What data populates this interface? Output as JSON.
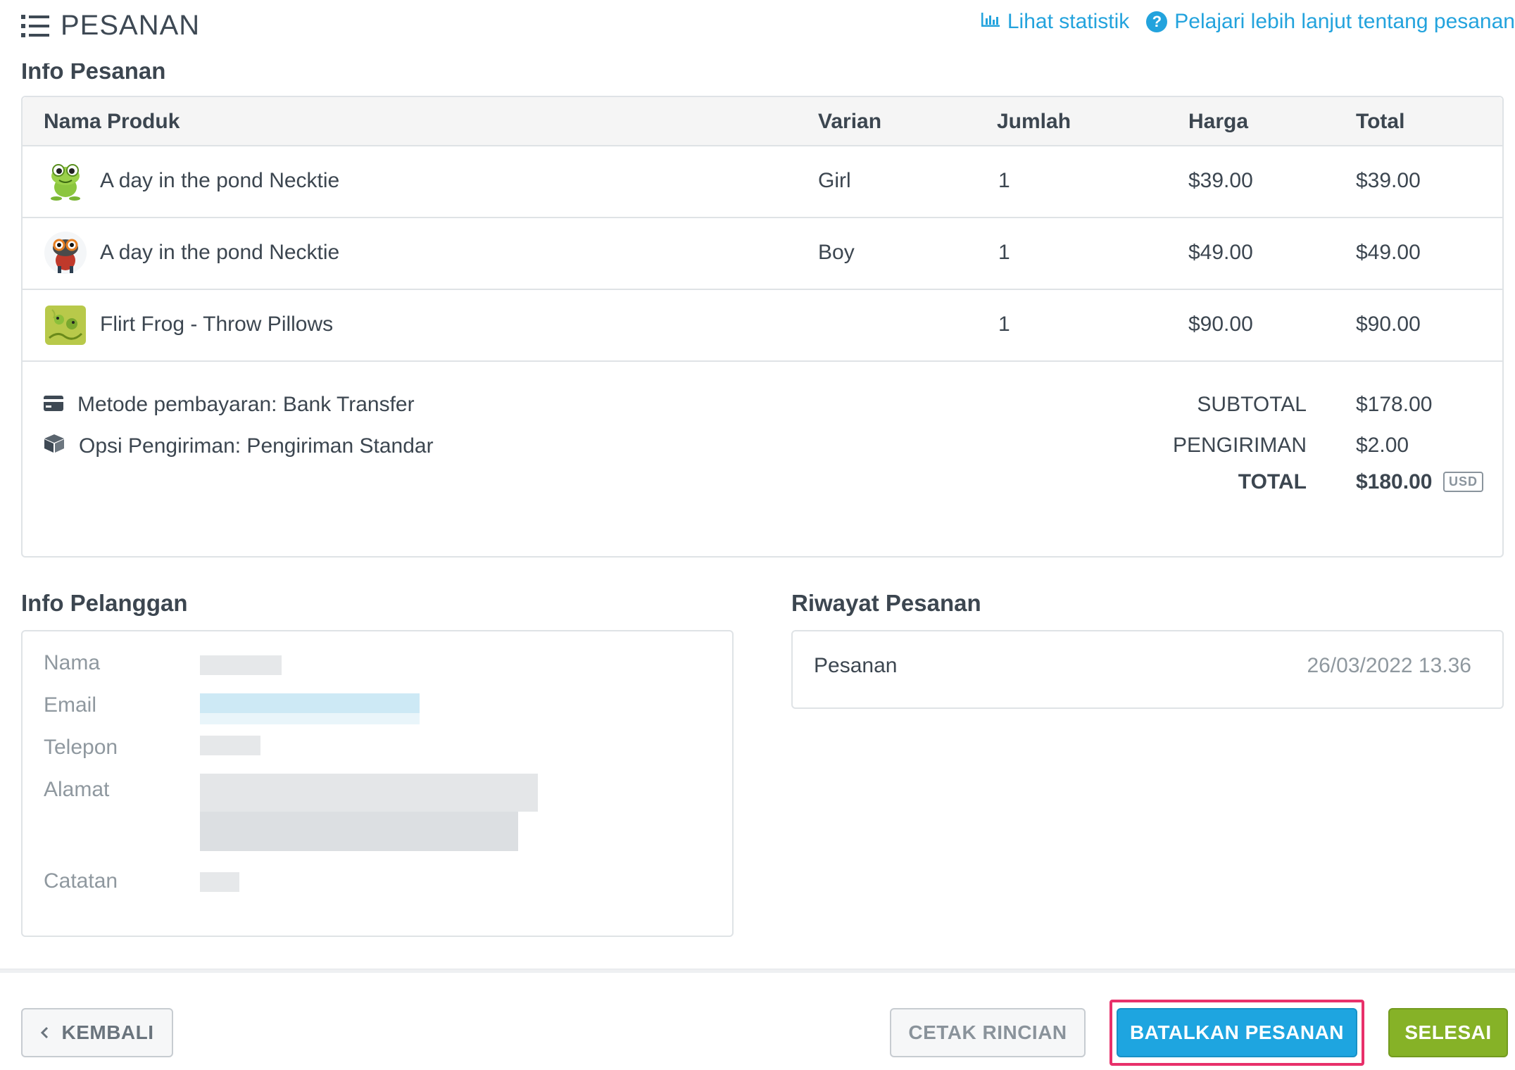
{
  "header": {
    "title": "PESANAN",
    "stats_link": "Lihat statistik",
    "learn_link": "Pelajari lebih lanjut tentang pesanan",
    "link_color": "#23a3dd"
  },
  "order_info": {
    "heading": "Info Pesanan",
    "columns": [
      "Nama Produk",
      "Varian",
      "Jumlah",
      "Harga",
      "Total"
    ],
    "items": [
      {
        "name": "A day in the pond Necktie",
        "variant": "Girl",
        "qty": "1",
        "price": "$39.00",
        "total": "$39.00",
        "thumb": "green-frog"
      },
      {
        "name": "A day in the pond Necktie",
        "variant": "Boy",
        "qty": "1",
        "price": "$49.00",
        "total": "$49.00",
        "thumb": "frog-with-glasses"
      },
      {
        "name": "Flirt Frog - Throw Pillows",
        "variant": "",
        "qty": "1",
        "price": "$90.00",
        "total": "$90.00",
        "thumb": "frog-pillow"
      }
    ],
    "payment": "Metode pembayaran: Bank Transfer",
    "shipping_option": "Opsi Pengiriman: Pengiriman Standar",
    "subtotal_label": "SUBTOTAL",
    "subtotal_value": "$178.00",
    "shipping_label": "PENGIRIMAN",
    "shipping_value": "$2.00",
    "total_label": "TOTAL",
    "total_value": "$180.00",
    "currency": "USD"
  },
  "customer": {
    "heading": "Info Pelanggan",
    "labels": {
      "name": "Nama",
      "email": "Email",
      "phone": "Telepon",
      "address": "Alamat",
      "note": "Catatan"
    }
  },
  "history": {
    "heading": "Riwayat Pesanan",
    "entries": [
      {
        "label": "Pesanan",
        "date": "26/03/2022 13.36"
      }
    ]
  },
  "footer": {
    "back": "KEMBALI",
    "print": "CETAK RINCIAN",
    "cancel": "BATALKAN PESANAN",
    "done": "SELESAI",
    "cancel_color": "#1ea5e0",
    "done_color": "#86b227",
    "highlight_color": "#e8306a"
  }
}
